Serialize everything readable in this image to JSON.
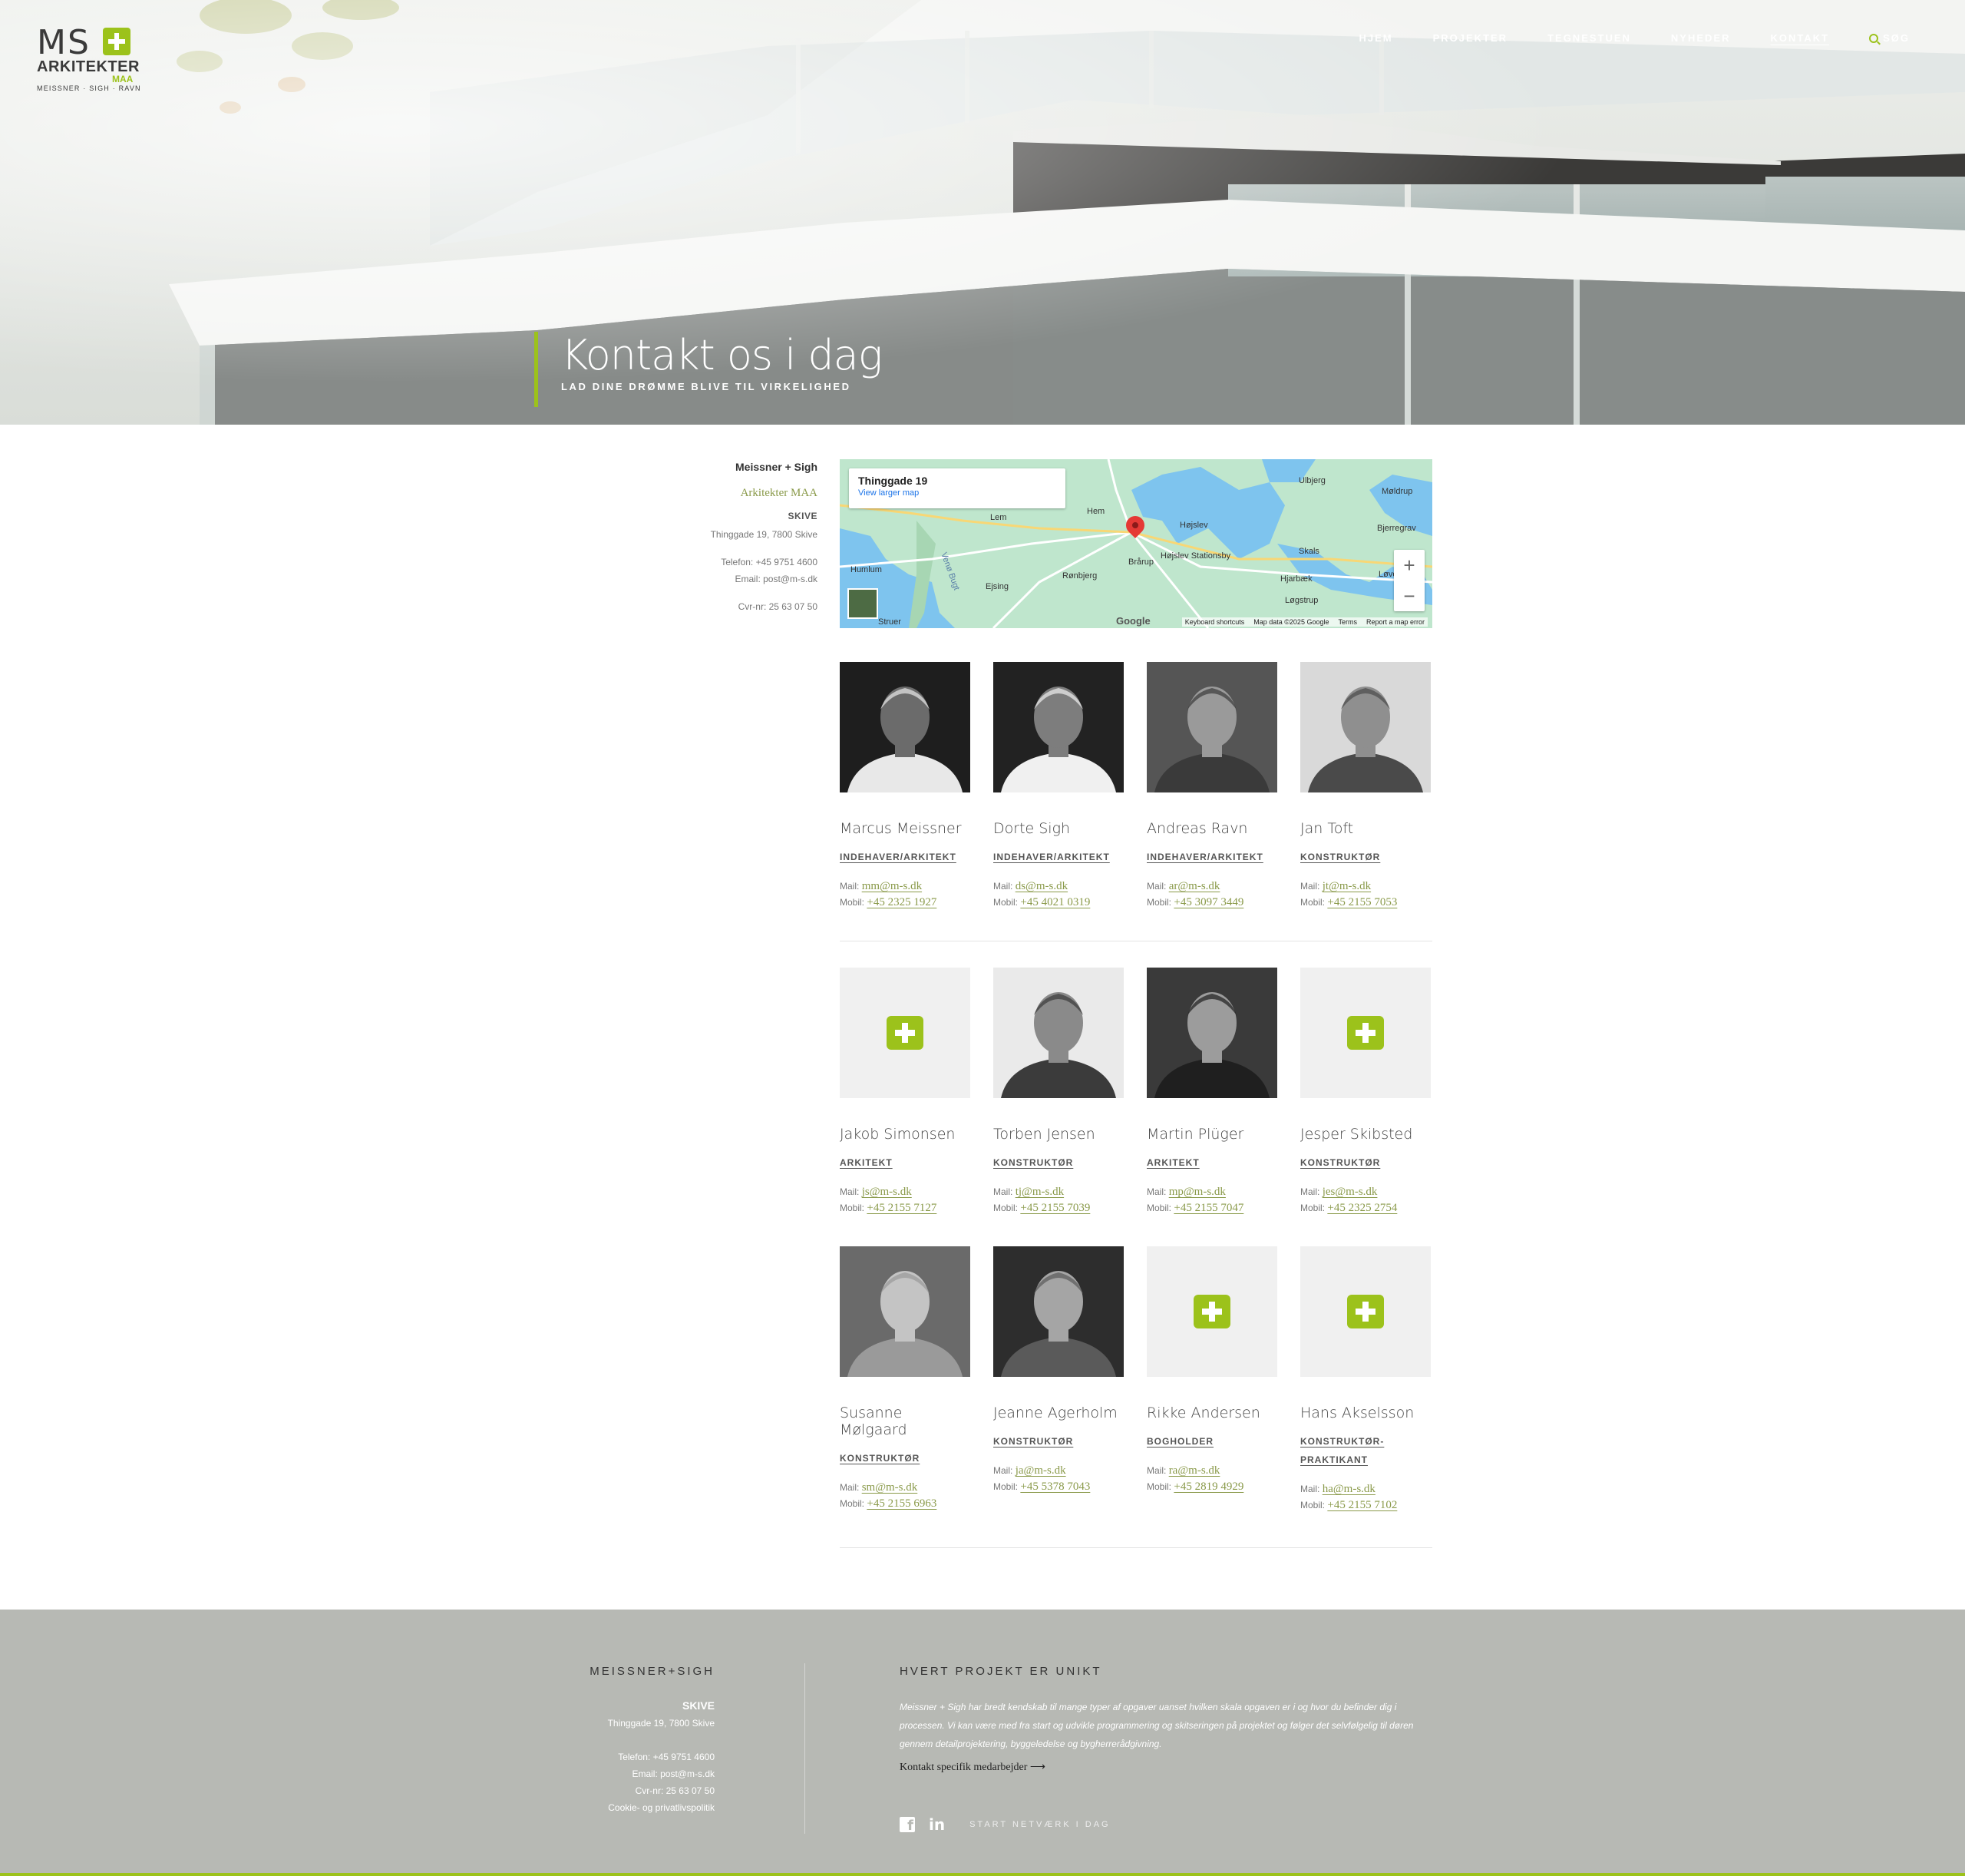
{
  "logo": {
    "ms": "MS",
    "ark": "ARKITEKTER",
    "maa": "MAA",
    "sub": "MEISSNER · SIGH · RAVN"
  },
  "nav": [
    {
      "label": "HJEM",
      "active": false
    },
    {
      "label": "PROJEKTER",
      "active": false
    },
    {
      "label": "TEGNESTUEN",
      "active": false
    },
    {
      "label": "NYHEDER",
      "active": false
    },
    {
      "label": "KONTAKT",
      "active": true
    }
  ],
  "search_label": "SØG",
  "hero": {
    "title": "Kontakt os i dag",
    "subtitle": "LAD DINE DRØMME BLIVE TIL VIRKELIGHED"
  },
  "info": {
    "name1": "Meissner + Sigh",
    "name2": "Arkitekter MAA",
    "city": "SKIVE",
    "address": "Thinggade 19, 7800 Skive",
    "phone": "Telefon: +45 9751 4600",
    "email": "Email: post@m-s.dk",
    "cvr": "Cvr-nr: 25 63 07 50"
  },
  "map": {
    "place": "Thinggade 19",
    "link": "View larger map",
    "labels": [
      "Lem",
      "Hem",
      "Højslev",
      "Højslev Stationsby",
      "Brårup",
      "Rønbjerg",
      "Ejsing",
      "Humlum",
      "Venø Bugt",
      "Ulbjerg",
      "Møldrup",
      "Bjerregrav",
      "Skals",
      "Hjarbæk",
      "Løvel",
      "Løgstrup",
      "Struer"
    ],
    "footer": [
      "Keyboard shortcuts",
      "Map data ©2025 Google",
      "Terms",
      "Report a map error"
    ]
  },
  "mail_prefix": "Mail:",
  "mobile_prefix": "Mobil:",
  "staff": [
    {
      "name": "Marcus Meissner",
      "role": "INDEHAVER/ARKITEKT",
      "mail": "mm@m-s.dk",
      "mobile": "+45 2325 1927",
      "photo": true
    },
    {
      "name": "Dorte Sigh",
      "role": "INDEHAVER/ARKITEKT",
      "mail": "ds@m-s.dk",
      "mobile": "+45 4021 0319",
      "photo": true
    },
    {
      "name": "Andreas Ravn",
      "role": "INDEHAVER/ARKITEKT",
      "mail": "ar@m-s.dk",
      "mobile": "+45 3097 3449",
      "photo": true
    },
    {
      "name": "Jan Toft",
      "role": "KONSTRUKTØR",
      "mail": "jt@m-s.dk",
      "mobile": "+45 2155 7053",
      "photo": true
    },
    {
      "name": "Jakob Simonsen",
      "role": "ARKITEKT",
      "mail": "js@m-s.dk",
      "mobile": "+45 2155 7127",
      "photo": false
    },
    {
      "name": "Torben Jensen",
      "role": "KONSTRUKTØR",
      "mail": "tj@m-s.dk",
      "mobile": "+45 2155 7039",
      "photo": true
    },
    {
      "name": "Martin Plüger",
      "role": "ARKITEKT",
      "mail": "mp@m-s.dk",
      "mobile": "+45 2155 7047",
      "photo": true
    },
    {
      "name": "Jesper Skibsted",
      "role": "KONSTRUKTØR",
      "mail": "jes@m-s.dk",
      "mobile": "+45 2325 2754",
      "photo": false
    },
    {
      "name": "Susanne Mølgaard",
      "role": "KONSTRUKTØR",
      "mail": "sm@m-s.dk",
      "mobile": "+45 2155 6963",
      "photo": true
    },
    {
      "name": "Jeanne Agerholm",
      "role": "KONSTRUKTØR",
      "mail": "ja@m-s.dk",
      "mobile": "+45 5378 7043",
      "photo": true
    },
    {
      "name": "Rikke Andersen",
      "role": "BOGHOLDER",
      "mail": "ra@m-s.dk",
      "mobile": "+45 2819 4929",
      "photo": false
    },
    {
      "name": "Hans Akselsson",
      "role": "KONSTRUKTØR-PRAKTIKANT",
      "mail": "ha@m-s.dk",
      "mobile": "+45 2155 7102",
      "photo": false
    }
  ],
  "footer": {
    "left_heading": "MEISSNER+SIGH",
    "city": "SKIVE",
    "address": "Thinggade 19, 7800 Skive",
    "phone": "Telefon: +45 9751 4600",
    "email": "Email: post@m-s.dk",
    "cvr": "Cvr-nr: 25 63 07 50",
    "cookie": "Cookie- og privatlivspolitik",
    "right_heading": "HVERT PROJEKT ER UNIKT",
    "description": "Meissner + Sigh har bredt kendskab til mange typer af opgaver uanset hvilken skala opgaven er i og hvor du befinder dig i processen. Vi kan være med fra start og udvikle programmering og skitseringen på projektet og følger det selvfølgelig til døren gennem detailprojektering, byggeledelse og bygherrerådgivning.",
    "contact_link": "Kontakt specifik medarbejder ⟶",
    "network": "START NETVÆRK I DAG"
  },
  "colors": {
    "accent": "#9cc21b",
    "link": "#8a9a4a",
    "footer_bg": "#b7b9b4"
  }
}
